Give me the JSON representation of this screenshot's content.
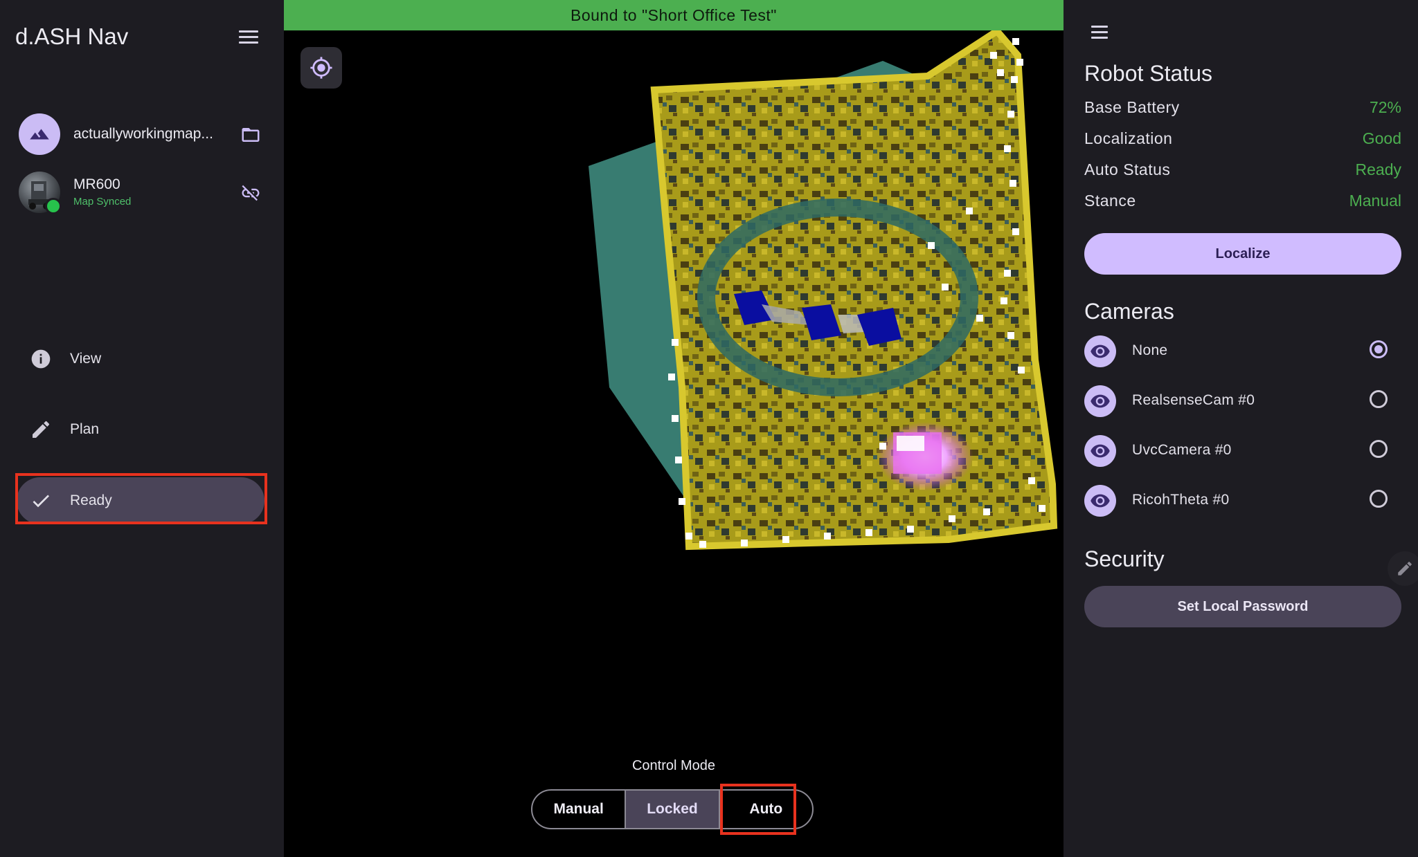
{
  "app": {
    "title": "d.ASH Nav"
  },
  "sidebar": {
    "map": {
      "name": "actuallyworkingmap...",
      "icon": "terrain-icon",
      "action_icon": "folder-icon"
    },
    "robot": {
      "name": "MR600",
      "status": "Map Synced",
      "status_color": "#4fc06a",
      "action_icon": "link-off-icon"
    },
    "nav": [
      {
        "label": "View",
        "icon": "info-icon"
      },
      {
        "label": "Plan",
        "icon": "pencil-icon"
      },
      {
        "label": "Ready",
        "icon": "check-icon",
        "active": true
      }
    ]
  },
  "map": {
    "banner": "Bound to \"Short Office Test\"",
    "banner_color": "#4caf50",
    "control_mode": {
      "label": "Control Mode",
      "options": [
        "Manual",
        "Locked",
        "Auto"
      ],
      "selected": "Locked"
    }
  },
  "robot_status": {
    "title": "Robot Status",
    "rows": [
      {
        "key": "Base Battery",
        "value": "72%"
      },
      {
        "key": "Localization",
        "value": "Good"
      },
      {
        "key": "Auto Status",
        "value": "Ready"
      },
      {
        "key": "Stance",
        "value": "Manual"
      }
    ],
    "localize_label": "Localize"
  },
  "cameras": {
    "title": "Cameras",
    "items": [
      {
        "name": "None",
        "selected": true
      },
      {
        "name": "RealsenseCam #0",
        "selected": false
      },
      {
        "name": "UvcCamera #0",
        "selected": false
      },
      {
        "name": "RicohTheta #0",
        "selected": false
      }
    ]
  },
  "security": {
    "title": "Security",
    "password_label": "Set Local Password"
  },
  "colors": {
    "accent": "#d0bcff",
    "status_green": "#4caf50",
    "highlight": "#e8321e"
  }
}
